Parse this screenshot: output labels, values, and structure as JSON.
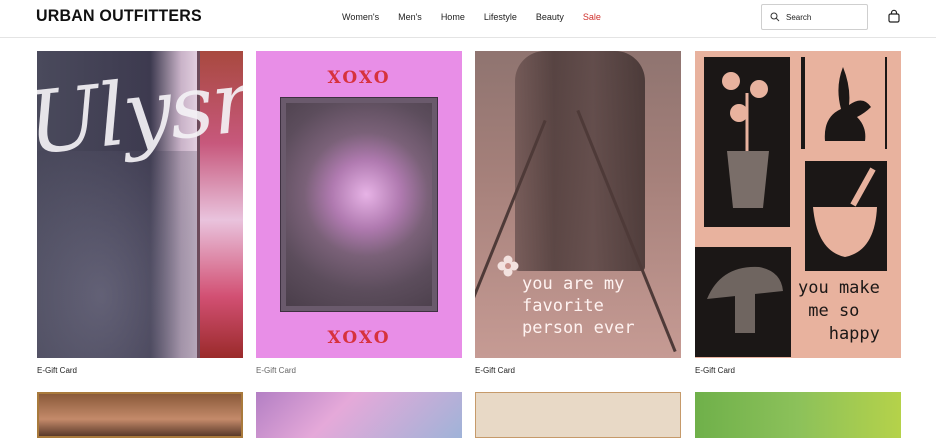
{
  "header": {
    "logo": "URBAN OUTFITTERS",
    "nav": [
      "Women's",
      "Men's",
      "Home",
      "Lifestyle",
      "Beauty",
      "Sale"
    ],
    "sale_color": "#d0312d",
    "search_placeholder": "Search",
    "search_icon": "search-icon",
    "bag_icon": "shopping-bag-icon"
  },
  "products": [
    {
      "caption": "E-Gift Card",
      "art_text": "Ulysm"
    },
    {
      "caption": "E-Gift Card",
      "art_top": "XOXO",
      "art_bottom": "XOXO"
    },
    {
      "caption": "E-Gift Card",
      "art_text": "you are my\nfavorite\nperson ever"
    },
    {
      "caption": "E-Gift Card",
      "art_text": "you make\n me so\n   happy"
    }
  ]
}
